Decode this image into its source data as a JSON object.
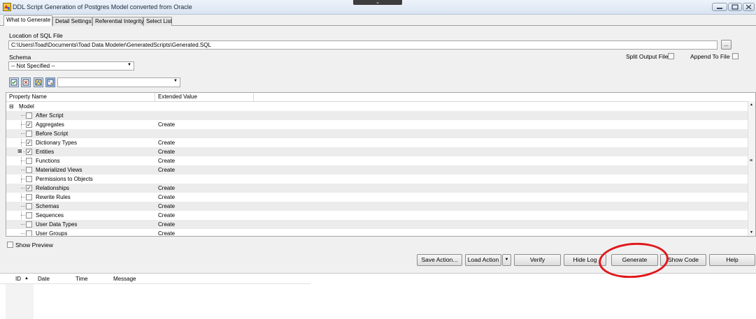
{
  "window": {
    "title": "DDL Script Generation of Postgres Model converted from Oracle",
    "drop_glyph": "⌄"
  },
  "tabs": [
    {
      "label": "What to Generate",
      "active": true
    },
    {
      "label": "Detail Settings",
      "active": false
    },
    {
      "label": "Referential Integrity",
      "active": false
    },
    {
      "label": "Select List",
      "active": false
    }
  ],
  "location": {
    "label": "Location of SQL File",
    "path": "C:\\Users\\Toad\\Documents\\Toad Data Modeler\\GeneratedScripts\\Generated.SQL",
    "browse_label": "..."
  },
  "schema": {
    "label": "Schema",
    "selected": "-- Not Specified --"
  },
  "options": {
    "split_output_label": "Split Output File",
    "append_label": "Append To File"
  },
  "grid": {
    "columns": [
      "Property Name",
      "Extended Value"
    ],
    "root": "Model",
    "rows": [
      {
        "name": "After Script",
        "checked": false,
        "value": ""
      },
      {
        "name": "Aggregates",
        "checked": true,
        "value": "Create"
      },
      {
        "name": "Before Script",
        "checked": false,
        "value": ""
      },
      {
        "name": "Dictionary Types",
        "checked": true,
        "value": "Create"
      },
      {
        "name": "Entities",
        "checked": true,
        "value": "Create",
        "expandable": true
      },
      {
        "name": "Functions",
        "checked": false,
        "value": "Create"
      },
      {
        "name": "Materialized Views",
        "checked": false,
        "value": "Create"
      },
      {
        "name": "Permissions to Objects",
        "checked": false,
        "value": ""
      },
      {
        "name": "Relationships",
        "checked": true,
        "value": "Create"
      },
      {
        "name": "Rewrite Rules",
        "checked": false,
        "value": "Create"
      },
      {
        "name": "Schemas",
        "checked": false,
        "value": "Create"
      },
      {
        "name": "Sequences",
        "checked": false,
        "value": "Create"
      },
      {
        "name": "User Data Types",
        "checked": false,
        "value": "Create"
      },
      {
        "name": "User Groups",
        "checked": false,
        "value": "Create"
      }
    ]
  },
  "preview": {
    "label": "Show Preview"
  },
  "buttons": {
    "save_action": "Save Action...",
    "load_action": "Load Action",
    "verify": "Verify",
    "hide_log": "Hide Log",
    "generate": "Generate",
    "show_code": "Show Code",
    "help": "Help"
  },
  "log": {
    "columns": [
      "ID",
      "Date",
      "Time",
      "Message"
    ]
  },
  "colors": {
    "highlight_circle": "#e0181c"
  }
}
